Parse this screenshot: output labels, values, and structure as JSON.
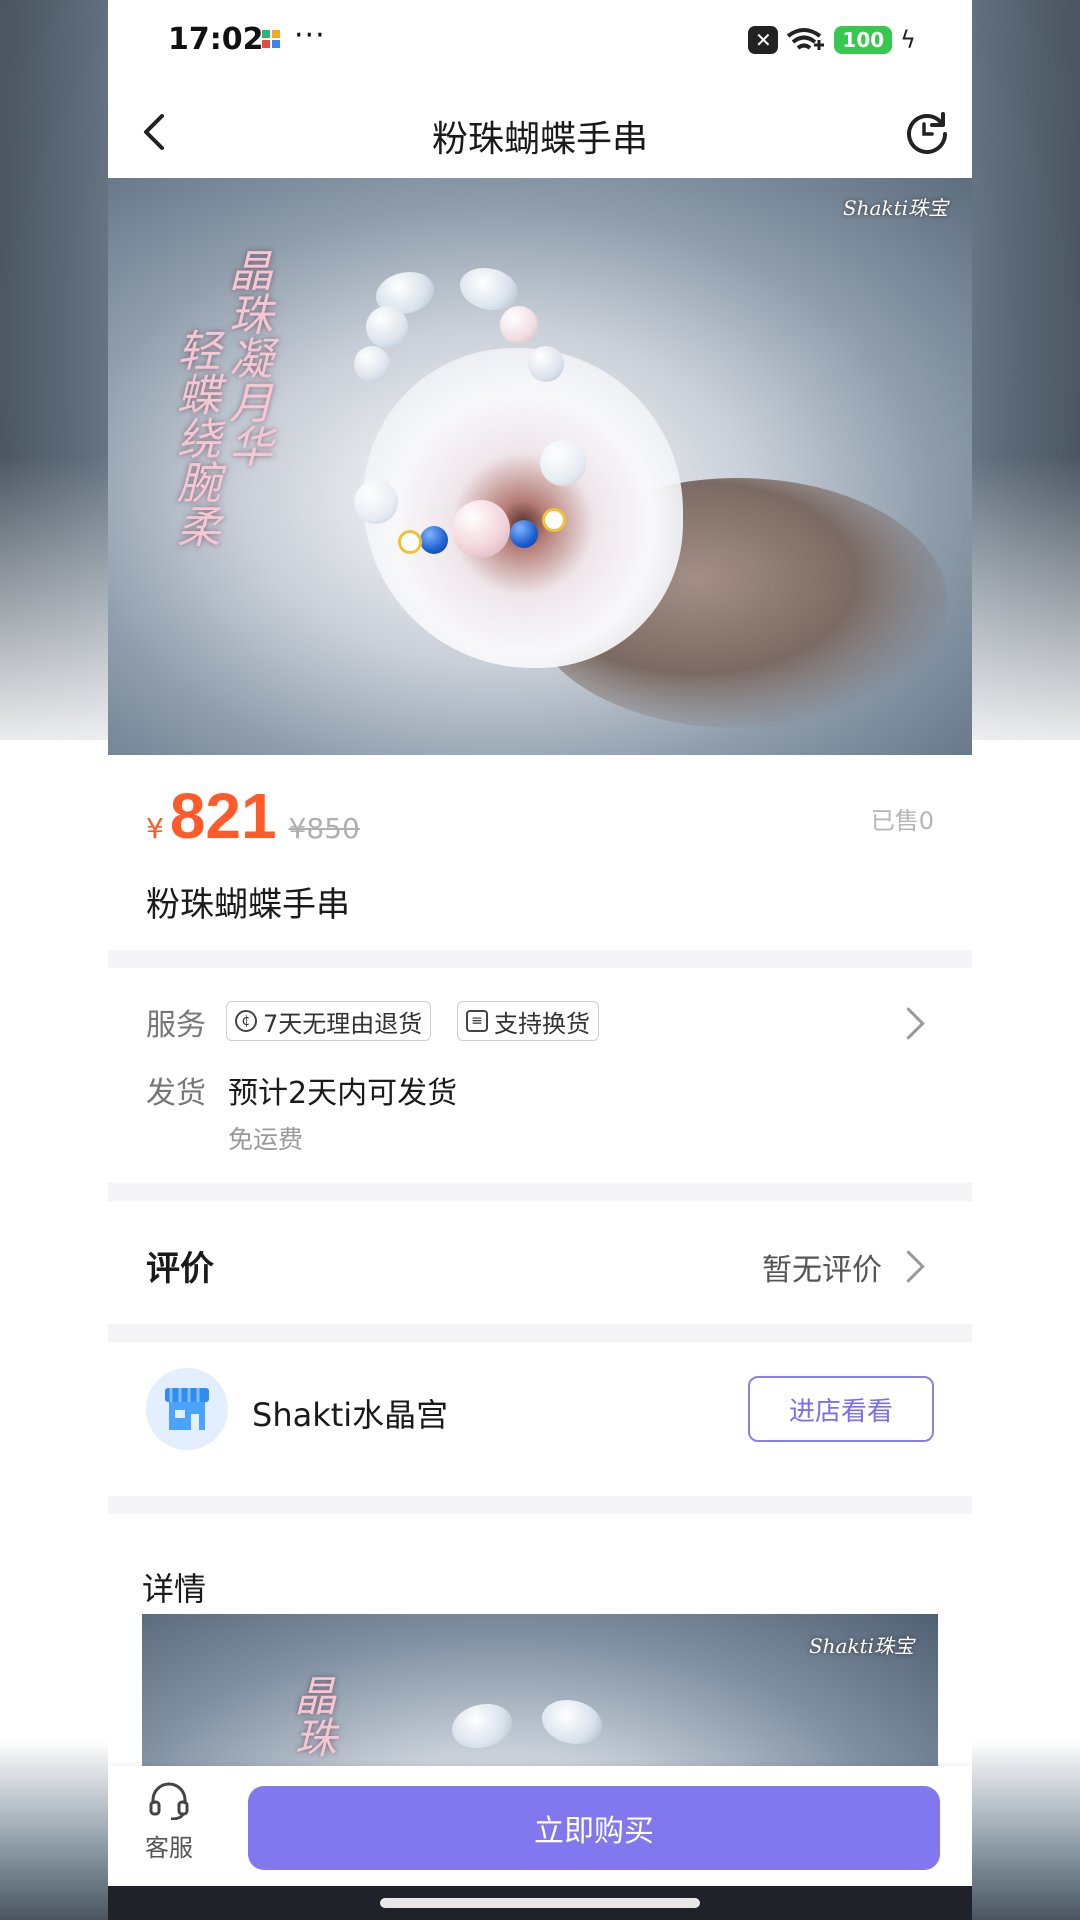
{
  "status_bar": {
    "time": "17:02",
    "more": "···",
    "battery": "100"
  },
  "nav": {
    "title": "粉珠蝴蝶手串"
  },
  "hero": {
    "poem_line1": "晶珠凝月华",
    "poem_line2": "轻蝶绕腕柔",
    "watermark": "Shakti珠宝"
  },
  "product": {
    "currency": "¥",
    "price": "821",
    "original_price": "¥850",
    "sold": "已售0",
    "title": "粉珠蝴蝶手串"
  },
  "service": {
    "label": "服务",
    "tags": [
      "7天无理由退货",
      "支持换货"
    ],
    "shipping_label": "发货",
    "shipping_text": "预计2天内可发货",
    "shipping_sub": "免运费"
  },
  "review": {
    "title": "评价",
    "status": "暂无评价"
  },
  "shop": {
    "name": "Shakti水晶宫",
    "button": "进店看看"
  },
  "detail": {
    "title": "详情",
    "poem_partial": "晶珠",
    "watermark": "Shakti珠宝"
  },
  "bottom": {
    "cs_label": "客服",
    "buy_label": "立即购买"
  },
  "colors": {
    "price": "#ff5a2a",
    "accent": "#8177ef"
  }
}
